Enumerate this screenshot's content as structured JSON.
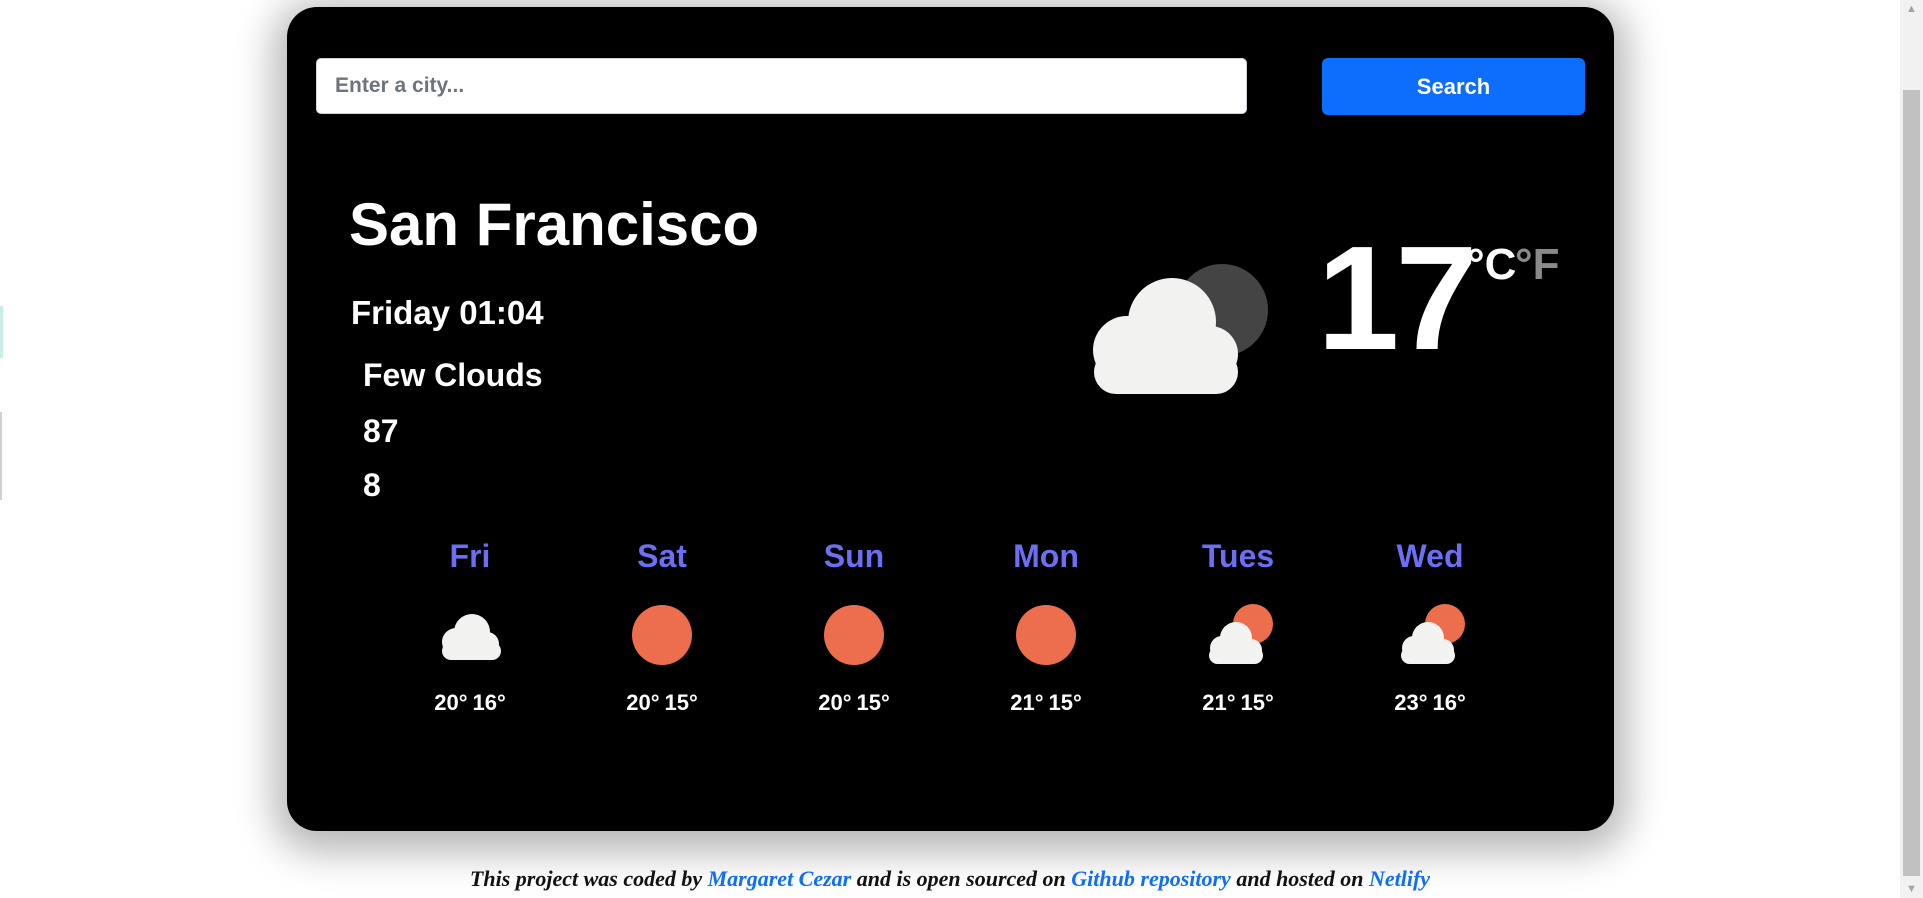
{
  "search": {
    "placeholder": "Enter a city...",
    "value": "",
    "button_label": "Search"
  },
  "current": {
    "city": "San Francisco",
    "datetime": "Friday 01:04",
    "description": "Few Clouds",
    "humidity": "87",
    "wind": "8",
    "temperature": "17",
    "unit_celsius": "°C",
    "unit_fahrenheit": "°F",
    "icon": "few-clouds-night-icon"
  },
  "forecast": [
    {
      "day": "Fri",
      "max": "20°",
      "min": "16°",
      "icon": "cloud-icon"
    },
    {
      "day": "Sat",
      "max": "20°",
      "min": "15°",
      "icon": "sun-icon"
    },
    {
      "day": "Sun",
      "max": "20°",
      "min": "15°",
      "icon": "sun-icon"
    },
    {
      "day": "Mon",
      "max": "21°",
      "min": "15°",
      "icon": "sun-icon"
    },
    {
      "day": "Tues",
      "max": "21°",
      "min": "15°",
      "icon": "partly-cloudy-icon"
    },
    {
      "day": "Wed",
      "max": "23°",
      "min": "16°",
      "icon": "partly-cloudy-icon"
    }
  ],
  "footer": {
    "text_1": "This project was coded by ",
    "author_link": "Margaret Cezar",
    "text_2": " and is open sourced on ",
    "repo_link": "Github repository",
    "text_3": " and hosted on ",
    "host_link": "Netlify"
  },
  "colors": {
    "card_bg": "#000000",
    "accent_button": "#0d6efd",
    "forecast_day": "#6c6ff3",
    "sun": "#ec6e4c",
    "cloud": "#f2f2f0",
    "moon": "#444444"
  }
}
